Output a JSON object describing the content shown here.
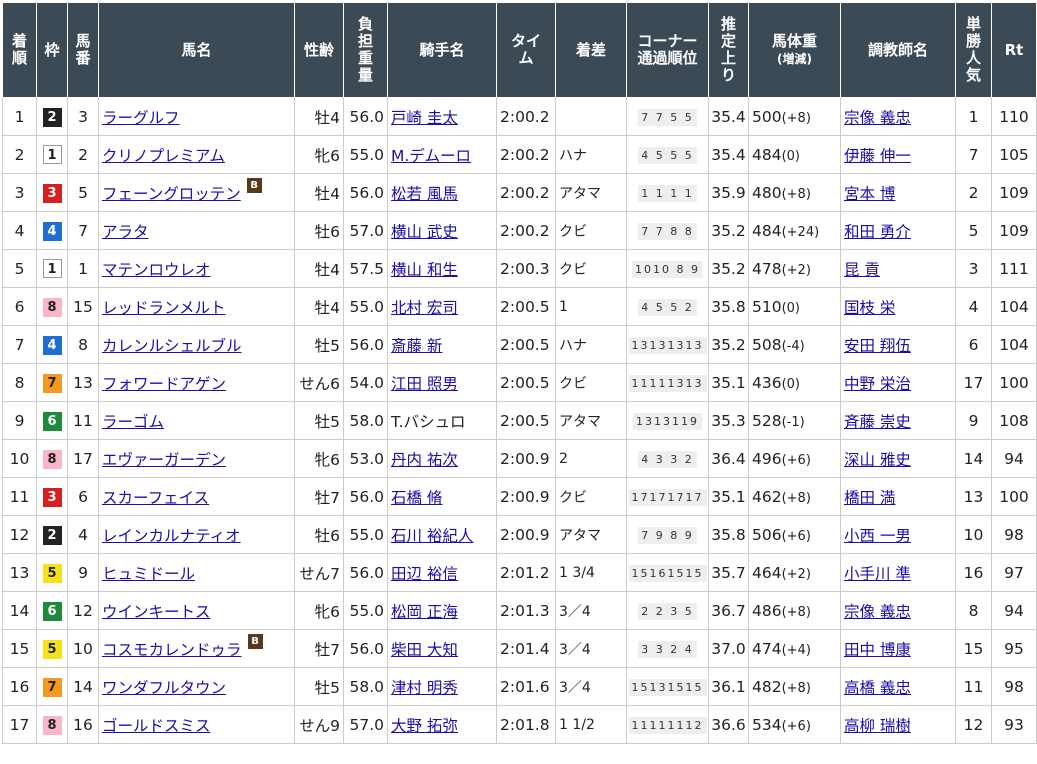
{
  "headers": {
    "rank": "着順",
    "waku": "枠",
    "umaban": "馬番",
    "horse": "馬名",
    "sexage": "性齢",
    "weight_carried": "負担重量",
    "jockey": "騎手名",
    "time": "タイム",
    "margin": "着差",
    "corner": "コーナー通過順位",
    "last3f": "推定上り",
    "body_weight": "馬体重",
    "body_weight_sub": "(増減)",
    "trainer": "調教師名",
    "popularity": "単勝人気",
    "rt": "Rt"
  },
  "rows": [
    {
      "rank": "1",
      "waku": "2",
      "umaban": "3",
      "horse": "ラーグルフ",
      "blinker": false,
      "sexage": "牡4",
      "weight": "56.0",
      "jockey": "戸崎 圭太",
      "jockey_link": true,
      "time": "2:00.2",
      "margin": "",
      "corner": "7 7 5 5",
      "last3f": "35.4",
      "bw": "500",
      "bwdiff": "(+8)",
      "trainer": "宗像 義忠",
      "pop": "1",
      "rt": "110"
    },
    {
      "rank": "2",
      "waku": "1",
      "umaban": "2",
      "horse": "クリノプレミアム",
      "blinker": false,
      "sexage": "牝6",
      "weight": "55.0",
      "jockey": "M.デムーロ",
      "jockey_link": true,
      "time": "2:00.2",
      "margin": "ハナ",
      "corner": "4 5 5 5",
      "last3f": "35.4",
      "bw": "484",
      "bwdiff": "(0)",
      "trainer": "伊藤 伸一",
      "pop": "7",
      "rt": "105"
    },
    {
      "rank": "3",
      "waku": "3",
      "umaban": "5",
      "horse": "フェーングロッテン",
      "blinker": true,
      "sexage": "牡4",
      "weight": "56.0",
      "jockey": "松若 風馬",
      "jockey_link": true,
      "time": "2:00.2",
      "margin": "アタマ",
      "corner": "1 1 1 1",
      "last3f": "35.9",
      "bw": "480",
      "bwdiff": "(+8)",
      "trainer": "宮本 博",
      "pop": "2",
      "rt": "109"
    },
    {
      "rank": "4",
      "waku": "4",
      "umaban": "7",
      "horse": "アラタ",
      "blinker": false,
      "sexage": "牡6",
      "weight": "57.0",
      "jockey": "横山 武史",
      "jockey_link": true,
      "time": "2:00.2",
      "margin": "クビ",
      "corner": "7 7 8 8",
      "last3f": "35.2",
      "bw": "484",
      "bwdiff": "(+24)",
      "trainer": "和田 勇介",
      "pop": "5",
      "rt": "109"
    },
    {
      "rank": "5",
      "waku": "1",
      "umaban": "1",
      "horse": "マテンロウレオ",
      "blinker": false,
      "sexage": "牡4",
      "weight": "57.5",
      "jockey": "横山 和生",
      "jockey_link": true,
      "time": "2:00.3",
      "margin": "クビ",
      "corner": "1010 8 9",
      "last3f": "35.2",
      "bw": "478",
      "bwdiff": "(+2)",
      "trainer": "昆 貢",
      "pop": "3",
      "rt": "111"
    },
    {
      "rank": "6",
      "waku": "8",
      "umaban": "15",
      "horse": "レッドランメルト",
      "blinker": false,
      "sexage": "牡4",
      "weight": "55.0",
      "jockey": "北村 宏司",
      "jockey_link": true,
      "time": "2:00.5",
      "margin": "1",
      "corner": "4 5 5 2",
      "last3f": "35.8",
      "bw": "510",
      "bwdiff": "(0)",
      "trainer": "国枝 栄",
      "pop": "4",
      "rt": "104"
    },
    {
      "rank": "7",
      "waku": "4",
      "umaban": "8",
      "horse": "カレンルシェルブル",
      "blinker": false,
      "sexage": "牡5",
      "weight": "56.0",
      "jockey": "斎藤 新",
      "jockey_link": true,
      "time": "2:00.5",
      "margin": "ハナ",
      "corner": "13131313",
      "last3f": "35.2",
      "bw": "508",
      "bwdiff": "(-4)",
      "trainer": "安田 翔伍",
      "pop": "6",
      "rt": "104"
    },
    {
      "rank": "8",
      "waku": "7",
      "umaban": "13",
      "horse": "フォワードアゲン",
      "blinker": false,
      "sexage": "せん6",
      "weight": "54.0",
      "jockey": "江田 照男",
      "jockey_link": true,
      "time": "2:00.5",
      "margin": "クビ",
      "corner": "11111313",
      "last3f": "35.1",
      "bw": "436",
      "bwdiff": "(0)",
      "trainer": "中野 栄治",
      "pop": "17",
      "rt": "100"
    },
    {
      "rank": "9",
      "waku": "6",
      "umaban": "11",
      "horse": "ラーゴム",
      "blinker": false,
      "sexage": "牡5",
      "weight": "58.0",
      "jockey": "T.バシュロ",
      "jockey_link": false,
      "time": "2:00.5",
      "margin": "アタマ",
      "corner": "1313119",
      "last3f": "35.3",
      "bw": "528",
      "bwdiff": "(-1)",
      "trainer": "斉藤 崇史",
      "pop": "9",
      "rt": "108"
    },
    {
      "rank": "10",
      "waku": "8",
      "umaban": "17",
      "horse": "エヴァーガーデン",
      "blinker": false,
      "sexage": "牝6",
      "weight": "53.0",
      "jockey": "丹内 祐次",
      "jockey_link": true,
      "time": "2:00.9",
      "margin": "2",
      "corner": "4 3 3 2",
      "last3f": "36.4",
      "bw": "496",
      "bwdiff": "(+6)",
      "trainer": "深山 雅史",
      "pop": "14",
      "rt": "94"
    },
    {
      "rank": "11",
      "waku": "3",
      "umaban": "6",
      "horse": "スカーフェイス",
      "blinker": false,
      "sexage": "牡7",
      "weight": "56.0",
      "jockey": "石橋 脩",
      "jockey_link": true,
      "time": "2:00.9",
      "margin": "クビ",
      "corner": "17171717",
      "last3f": "35.1",
      "bw": "462",
      "bwdiff": "(+8)",
      "trainer": "橋田 満",
      "pop": "13",
      "rt": "100"
    },
    {
      "rank": "12",
      "waku": "2",
      "umaban": "4",
      "horse": "レインカルナティオ",
      "blinker": false,
      "sexage": "牡6",
      "weight": "55.0",
      "jockey": "石川 裕紀人",
      "jockey_link": true,
      "time": "2:00.9",
      "margin": "アタマ",
      "corner": "7 9 8 9",
      "last3f": "35.8",
      "bw": "506",
      "bwdiff": "(+6)",
      "trainer": "小西 一男",
      "pop": "10",
      "rt": "98"
    },
    {
      "rank": "13",
      "waku": "5",
      "umaban": "9",
      "horse": "ヒュミドール",
      "blinker": false,
      "sexage": "せん7",
      "weight": "56.0",
      "jockey": "田辺 裕信",
      "jockey_link": true,
      "time": "2:01.2",
      "margin": "1 3/4",
      "corner": "15161515",
      "last3f": "35.7",
      "bw": "464",
      "bwdiff": "(+2)",
      "trainer": "小手川 準",
      "pop": "16",
      "rt": "97"
    },
    {
      "rank": "14",
      "waku": "6",
      "umaban": "12",
      "horse": "ウインキートス",
      "blinker": false,
      "sexage": "牝6",
      "weight": "55.0",
      "jockey": "松岡 正海",
      "jockey_link": true,
      "time": "2:01.3",
      "margin": "3／4",
      "corner": "2 2 3 5",
      "last3f": "36.7",
      "bw": "486",
      "bwdiff": "(+8)",
      "trainer": "宗像 義忠",
      "pop": "8",
      "rt": "94"
    },
    {
      "rank": "15",
      "waku": "5",
      "umaban": "10",
      "horse": "コスモカレンドゥラ",
      "blinker": true,
      "sexage": "牡7",
      "weight": "56.0",
      "jockey": "柴田 大知",
      "jockey_link": true,
      "time": "2:01.4",
      "margin": "3／4",
      "corner": "3 3 2 4",
      "last3f": "37.0",
      "bw": "474",
      "bwdiff": "(+4)",
      "trainer": "田中 博康",
      "pop": "15",
      "rt": "95"
    },
    {
      "rank": "16",
      "waku": "7",
      "umaban": "14",
      "horse": "ワンダフルタウン",
      "blinker": false,
      "sexage": "牡5",
      "weight": "58.0",
      "jockey": "津村 明秀",
      "jockey_link": true,
      "time": "2:01.6",
      "margin": "3／4",
      "corner": "15131515",
      "last3f": "36.1",
      "bw": "482",
      "bwdiff": "(+8)",
      "trainer": "高橋 義忠",
      "pop": "11",
      "rt": "98"
    },
    {
      "rank": "17",
      "waku": "8",
      "umaban": "16",
      "horse": "ゴールドスミス",
      "blinker": false,
      "sexage": "せん9",
      "weight": "57.0",
      "jockey": "大野 拓弥",
      "jockey_link": true,
      "time": "2:01.8",
      "margin": "1 1/2",
      "corner": "11111112",
      "last3f": "36.6",
      "bw": "534",
      "bwdiff": "(+6)",
      "trainer": "高柳 瑞樹",
      "pop": "12",
      "rt": "93"
    }
  ],
  "blinker_label": "B",
  "colors": {
    "header_bg": "#3b4a55",
    "link": "#1a0dab"
  }
}
